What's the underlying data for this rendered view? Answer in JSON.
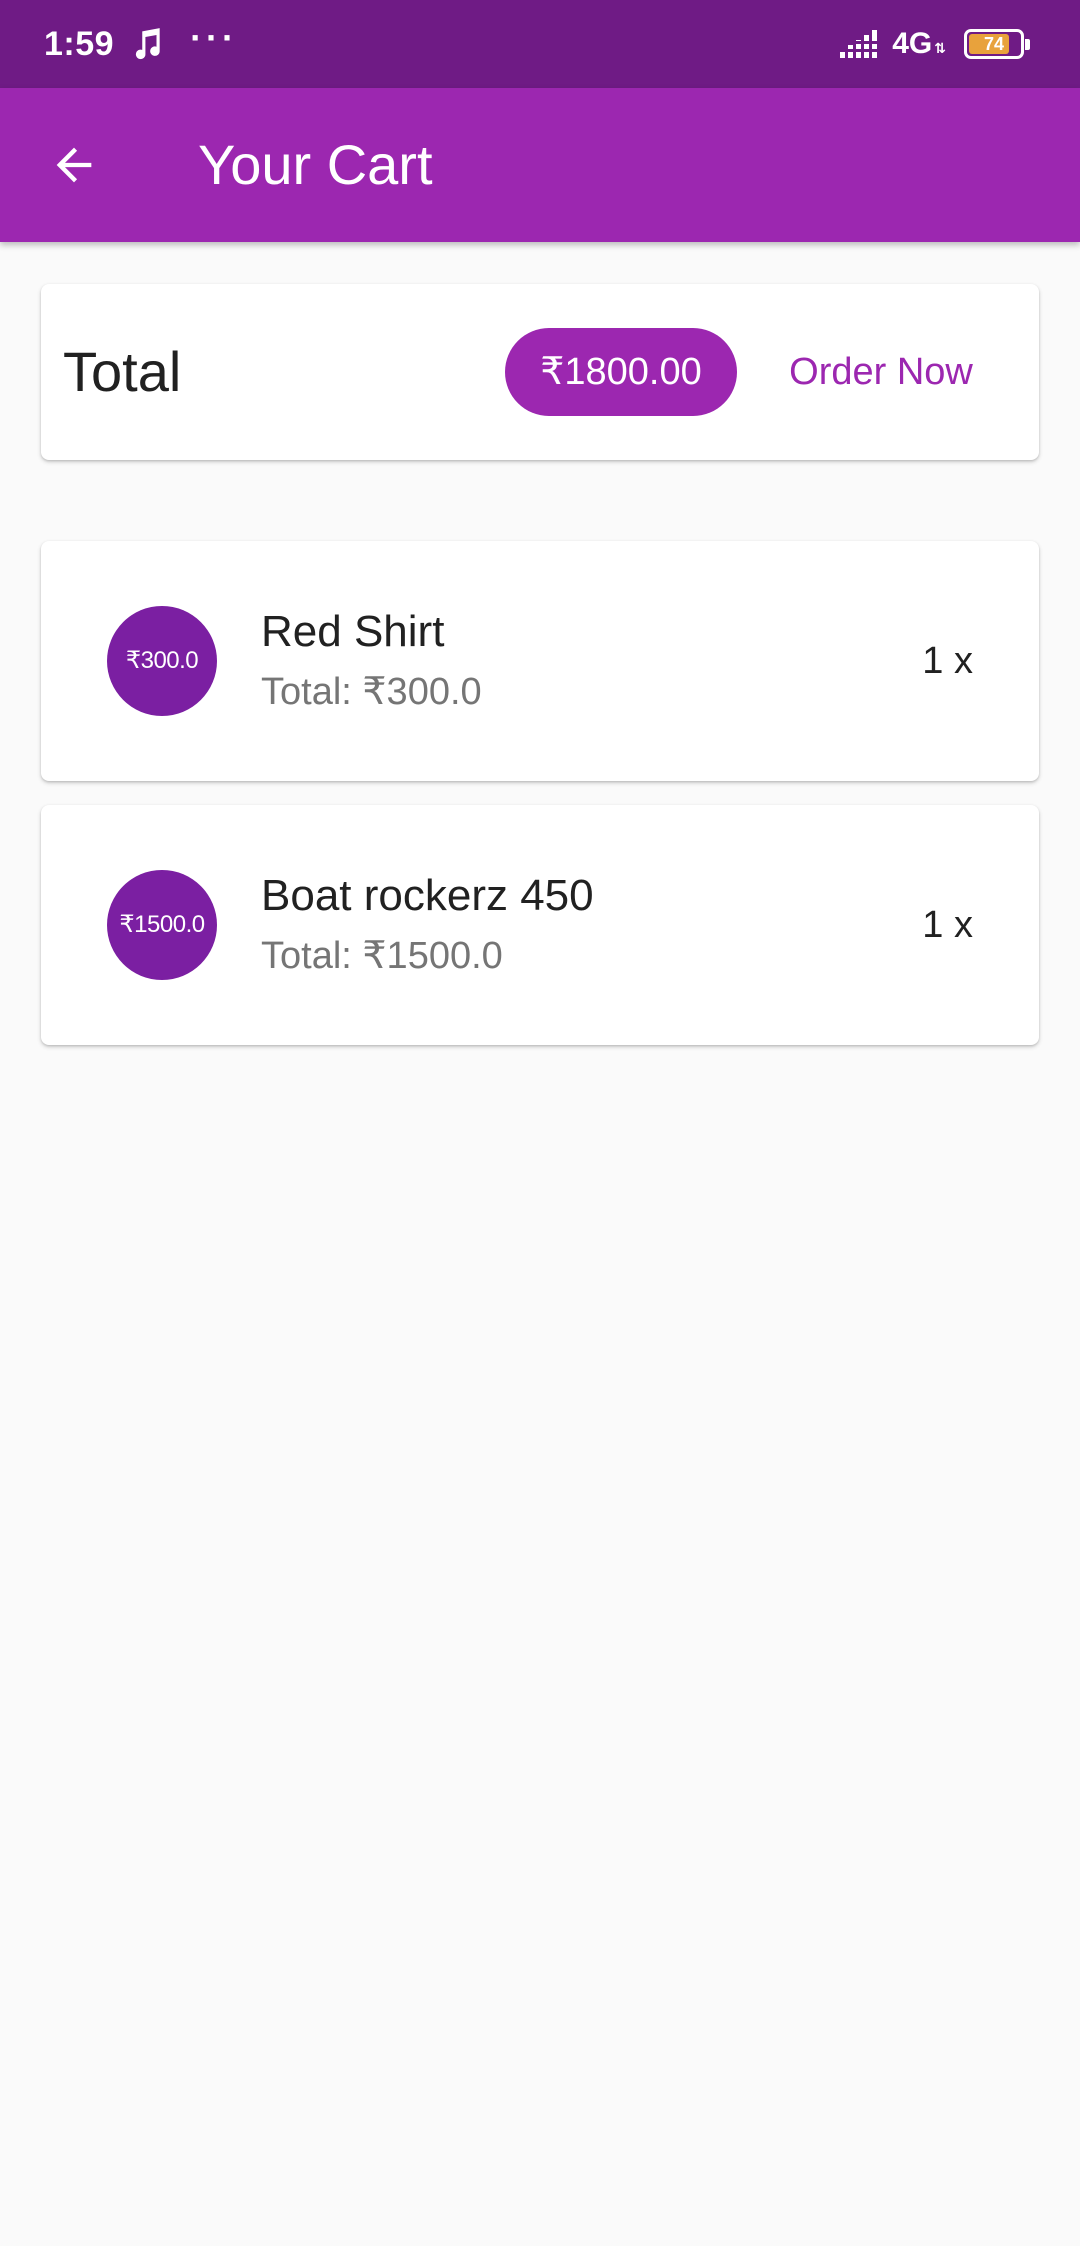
{
  "status_bar": {
    "time": "1:59",
    "more_indicator": "···",
    "network": "4G",
    "network_arrows": "⇅",
    "battery": "74"
  },
  "app_bar": {
    "title": "Your Cart",
    "back_icon": "arrow-back-icon"
  },
  "summary": {
    "label": "Total",
    "amount": "₹1800.00",
    "order_button": "Order Now"
  },
  "items": [
    {
      "avatar_price": "₹300.0",
      "title": "Red Shirt",
      "subtitle": "Total: ₹300.0",
      "quantity": "1 x"
    },
    {
      "avatar_price": "₹1500.0",
      "title": "Boat rockerz 450",
      "subtitle": "Total: ₹1500.0",
      "quantity": "1 x"
    }
  ],
  "colors": {
    "status_bar": "#6f1b85",
    "primary": "#9c27b0",
    "avatar": "#7b1fa2",
    "background": "#fafafa"
  }
}
